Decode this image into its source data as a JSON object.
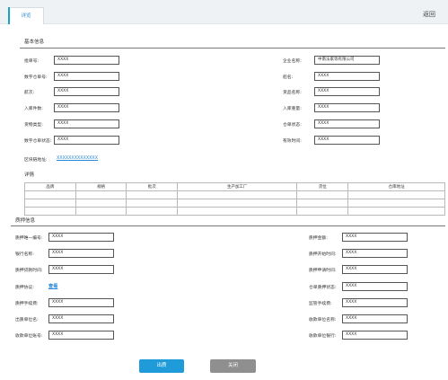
{
  "topbar": {
    "tab_label": "详览",
    "back_label": "返回"
  },
  "basic": {
    "title": "基本信息",
    "left_fields": [
      {
        "label": "批单号:",
        "value": "XXXX"
      },
      {
        "label": "数字仓单号:",
        "value": "XXXX"
      },
      {
        "label": "航次:",
        "value": "XXXX"
      },
      {
        "label": "入库件数:",
        "value": "XXXX"
      },
      {
        "label": "货物类型:",
        "value": "XXXX"
      },
      {
        "label": "数字仓单状态:",
        "value": "XXXX"
      }
    ],
    "right_fields": [
      {
        "label": "企业名称:",
        "value": "中南法家等有限公司"
      },
      {
        "label": "船名:",
        "value": "XXXX"
      },
      {
        "label": "货品名称:",
        "value": "XXXX"
      },
      {
        "label": "入库重量:",
        "value": "XXXX"
      },
      {
        "label": "仓单状态:",
        "value": "XXXX"
      },
      {
        "label": "有效时间:",
        "value": "XXXX"
      }
    ],
    "chain_label": "区块链地址:",
    "chain_value": "XXXXXXXXXXXXXX"
  },
  "detail": {
    "title": "详情",
    "headers": [
      "品牌",
      "规格",
      "批次",
      "生产加工厂",
      "货位",
      "仓库地址"
    ],
    "rows": [
      [
        "",
        "",
        "",
        "",
        "",
        ""
      ],
      [
        "",
        "",
        "",
        "",
        "",
        ""
      ],
      [
        "",
        "",
        "",
        "",
        "",
        ""
      ]
    ]
  },
  "pledge": {
    "title": "质押信息",
    "left_fields": [
      {
        "label": "质押唯一编号:",
        "value": "XXXX"
      },
      {
        "label": "银行名称:",
        "value": "XXXX"
      },
      {
        "label": "质押贷款时间:",
        "value": "XXXX"
      },
      {
        "label": "质押协议:",
        "value": "查看",
        "is_link": true
      },
      {
        "label": "质押手续费:",
        "value": "XXXX"
      },
      {
        "label": "出质单位名:",
        "value": "XXXX"
      },
      {
        "label": "收款单位账号:",
        "value": "XXXX"
      }
    ],
    "right_fields": [
      {
        "label": "质押金额:",
        "value": "XXXX"
      },
      {
        "label": "质押开始时间:",
        "value": "XXXX"
      },
      {
        "label": "质押申请时间:",
        "value": "XXXX"
      },
      {
        "label": "仓单质押状态:",
        "value": "XXXX"
      },
      {
        "label": "监管手续费:",
        "value": "XXXX"
      },
      {
        "label": "收款单位名称:",
        "value": "XXXX"
      },
      {
        "label": "收款单位银行:",
        "value": "XXXX"
      }
    ]
  },
  "footer": {
    "primary_label": "出质",
    "secondary_label": "关闭"
  },
  "colors": {
    "accent": "#1e9bd8",
    "grey_button": "#8f8f8f"
  }
}
